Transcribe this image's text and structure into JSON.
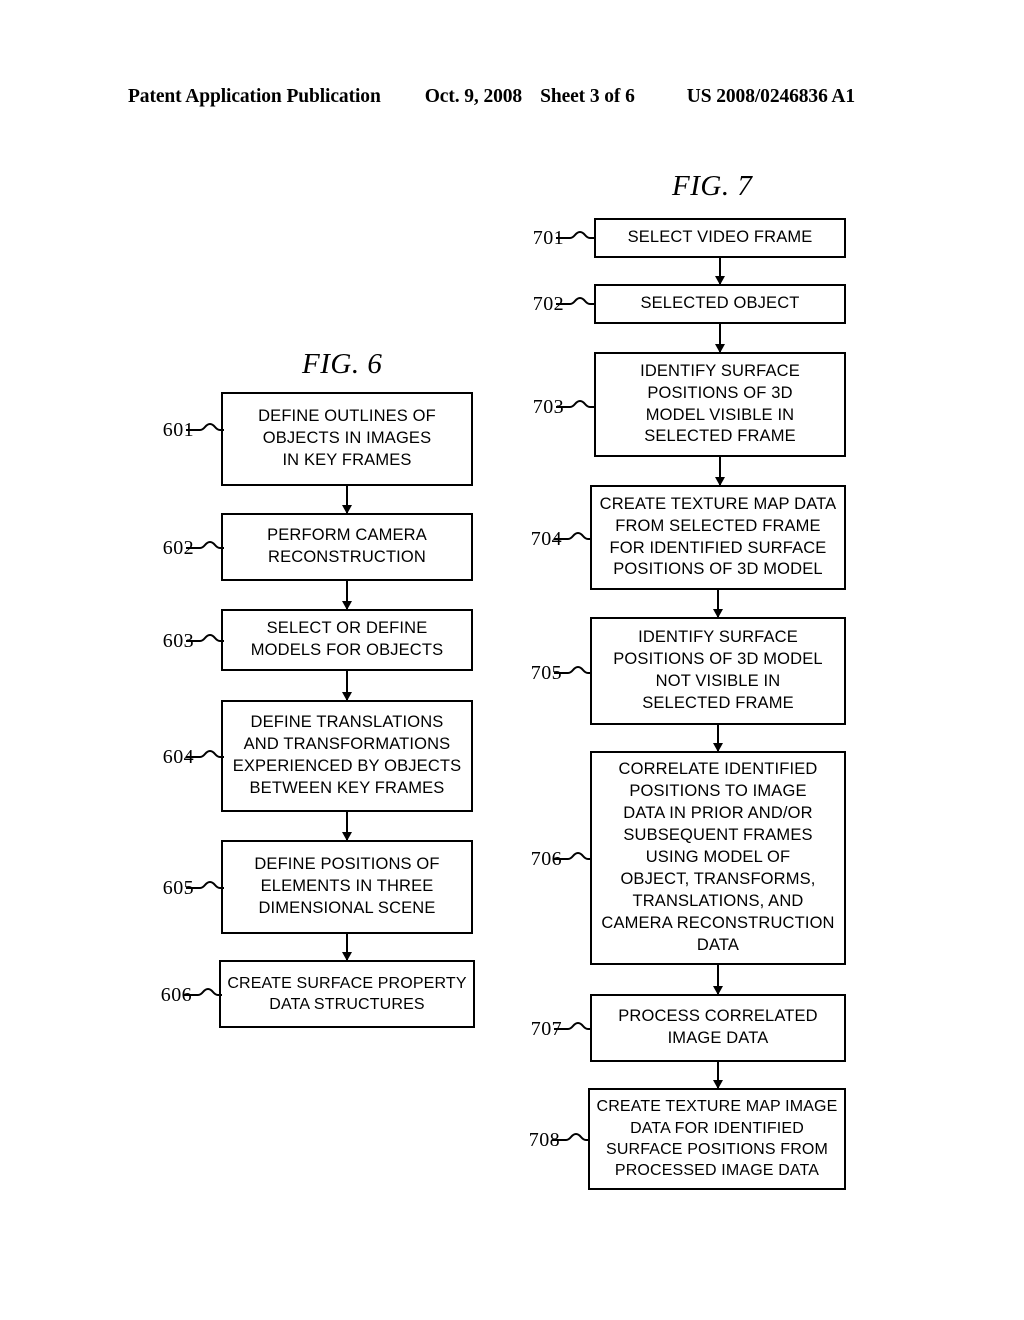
{
  "header": {
    "publication": "Patent Application Publication",
    "date": "Oct. 9, 2008",
    "sheet": "Sheet 3 of 6",
    "patent_number": "US 2008/0246836 A1"
  },
  "figures": [
    {
      "id": "fig6",
      "title": "FIG. 6",
      "nodes": [
        {
          "ref": "601",
          "text": "DEFINE OUTLINES OF\nOBJECTS IN IMAGES\nIN KEY FRAMES"
        },
        {
          "ref": "602",
          "text": "PERFORM CAMERA\nRECONSTRUCTION"
        },
        {
          "ref": "603",
          "text": "SELECT OR DEFINE\nMODELS FOR OBJECTS"
        },
        {
          "ref": "604",
          "text": "DEFINE TRANSLATIONS\nAND TRANSFORMATIONS\nEXPERIENCED BY OBJECTS\nBETWEEN KEY FRAMES"
        },
        {
          "ref": "605",
          "text": "DEFINE POSITIONS OF\nELEMENTS IN THREE\nDIMENSIONAL SCENE"
        },
        {
          "ref": "606",
          "text": "CREATE SURFACE PROPERTY\nDATA STRUCTURES"
        }
      ]
    },
    {
      "id": "fig7",
      "title": "FIG. 7",
      "nodes": [
        {
          "ref": "701",
          "text": "SELECT VIDEO FRAME"
        },
        {
          "ref": "702",
          "text": "SELECTED OBJECT"
        },
        {
          "ref": "703",
          "text": "IDENTIFY SURFACE\nPOSITIONS OF 3D\nMODEL VISIBLE IN\nSELECTED FRAME"
        },
        {
          "ref": "704",
          "text": "CREATE TEXTURE MAP DATA\nFROM SELECTED FRAME\nFOR IDENTIFIED SURFACE\nPOSITIONS OF 3D MODEL"
        },
        {
          "ref": "705",
          "text": "IDENTIFY SURFACE\nPOSITIONS OF 3D MODEL\nNOT VISIBLE IN\nSELECTED FRAME"
        },
        {
          "ref": "706",
          "text": "CORRELATE IDENTIFIED\nPOSITIONS TO IMAGE\nDATA IN PRIOR AND/OR\nSUBSEQUENT FRAMES\nUSING MODEL OF\nOBJECT, TRANSFORMS,\nTRANSLATIONS, AND\nCAMERA RECONSTRUCTION\nDATA"
        },
        {
          "ref": "707",
          "text": "PROCESS CORRELATED\nIMAGE DATA"
        },
        {
          "ref": "708",
          "text": "CREATE TEXTURE MAP IMAGE\nDATA FOR IDENTIFIED\nSURFACE POSITIONS FROM\nPROCESSED IMAGE DATA"
        }
      ]
    }
  ],
  "colors": {
    "ink": "#000000",
    "paper": "#ffffff"
  }
}
